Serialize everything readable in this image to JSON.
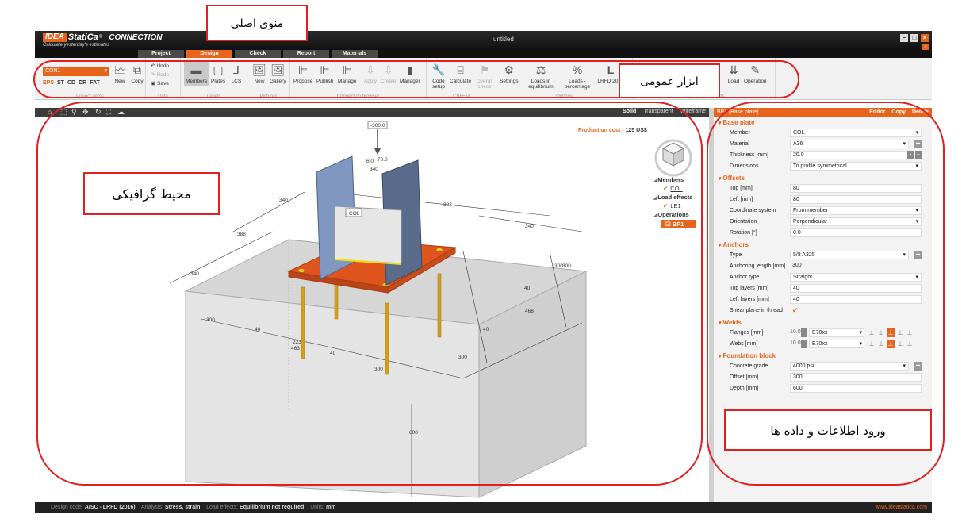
{
  "app": {
    "brand_idea": "IDEA",
    "brand_statica": "StatiCa",
    "product": "CONNECTION",
    "tagline": "Calculate yesterday's estimates",
    "document_title": "untitled"
  },
  "tabs": [
    {
      "label": "Project"
    },
    {
      "label": "Design"
    },
    {
      "label": "Check"
    },
    {
      "label": "Report"
    },
    {
      "label": "Materials"
    }
  ],
  "ribbon": {
    "connection_select": "CON1",
    "connection_types": [
      "EPS",
      "ST",
      "CD",
      "DR",
      "FAT"
    ],
    "project_items": {
      "new": "New",
      "copy": "Copy",
      "title": "Project items"
    },
    "data": {
      "undo": "Undo",
      "redo": "Redo",
      "save": "Save",
      "title": "Data"
    },
    "labels": {
      "members": "Members",
      "plates": "Plates",
      "lcs": "LCS",
      "title": "Labels"
    },
    "pictures": {
      "new": "New",
      "gallery": "Gallery",
      "title": "Pictures"
    },
    "connection_browser": {
      "propose": "Propose",
      "publish": "Publish",
      "manage": "Manage",
      "apply": "Apply",
      "create": "Create",
      "manager": "Manager",
      "title": "Connection browser"
    },
    "cbfem": {
      "code_setup": "Code setup",
      "calculate": "Calculate",
      "overall_check": "Overall check",
      "title": "CBFEM"
    },
    "options": {
      "settings": "Settings",
      "loads_eq": "Loads in equilibrium",
      "loads_pct": "Loads - percentage",
      "lrfd": "LRFD 2016",
      "title": "Options"
    },
    "import_export": {
      "load": "Load",
      "operation": "Operation",
      "title": "Import/Export loads"
    }
  },
  "view_modes": [
    "Solid",
    "Transparent",
    "Wireframe"
  ],
  "viewport": {
    "production_cost_label": "Production cost",
    "production_cost_value": "125 US$",
    "load_value": "-300.0",
    "member_label": "COL",
    "dims": {
      "d340a": "340",
      "d383": "383",
      "d340b": "340",
      "d388": "388",
      "d340c": "340",
      "d300a": "300",
      "d300b": "300",
      "d40a": "40",
      "d40b": "40",
      "d40c": "40",
      "d40d": "40",
      "d223": "223",
      "d463": "463",
      "d300c": "300",
      "d300d": "300",
      "d300e": "300",
      "d300f": "300",
      "d468": "468",
      "d600": "600",
      "d60": "6.0",
      "d70": "70.0",
      "d340t": "340"
    }
  },
  "tree": {
    "members_header": "Members",
    "member_item": "COL",
    "load_header": "Load effects",
    "load_item": "LE1",
    "ops_header": "Operations",
    "op_item": "BP1"
  },
  "panel": {
    "title": "BP1 [Base plate]",
    "actions": [
      "Editor",
      "Copy",
      "Delete"
    ],
    "base_plate": {
      "header": "Base plate",
      "member_label": "Member",
      "member": "COL",
      "material_label": "Material",
      "material": "A36",
      "thickness_label": "Thickness [mm]",
      "thickness": "20.0",
      "dimensions_label": "Dimensions",
      "dimensions": "To profile symmetrical"
    },
    "offsets": {
      "header": "Offsets",
      "top_label": "Top [mm]",
      "top": "80",
      "left_label": "Left [mm]",
      "left": "80",
      "coord_label": "Coordinate system",
      "coord": "From member",
      "orient_label": "Orientation",
      "orient": "Perpendicular",
      "rot_label": "Rotation [°]",
      "rot": "0.0"
    },
    "anchors": {
      "header": "Anchors",
      "type_label": "Type",
      "type": "5/8 A325",
      "anch_len_label": "Anchoring length [mm]",
      "anch_len": "300",
      "anchor_type_label": "Anchor type",
      "anchor_type": "Straight",
      "top_layers_label": "Top layers [mm]",
      "top_layers": "40",
      "left_layers_label": "Left layers [mm]",
      "left_layers": "40",
      "shear_label": "Shear plane in thread"
    },
    "welds": {
      "header": "Welds",
      "flanges_label": "Flanges [mm]",
      "flanges_size": "10.0",
      "flanges_mat": "E70xx",
      "webs_label": "Webs [mm]",
      "webs_size": "10.0",
      "webs_mat": "E70xx"
    },
    "foundation": {
      "header": "Foundation block",
      "grade_label": "Concrete grade",
      "grade": "4000 psi",
      "offset_label": "Offset [mm]",
      "offset": "300",
      "depth_label": "Depth [mm]",
      "depth": "600"
    }
  },
  "status": {
    "code_label": "Design code:",
    "code": "AISC - LRFD (2016)",
    "analysis_label": "Analysis:",
    "analysis": "Stress, strain",
    "load_label": "Load effects:",
    "load": "Equilibrium not required",
    "units_label": "Units:",
    "units": "mm",
    "url": "www.ideastatica.com"
  },
  "annotations": {
    "main_menu": "منوی اصلی",
    "general_tools": "ابزار عمومی",
    "graphic_env": "محیط گرافیکی",
    "data_entry": "ورود اطلاعات و داده ها"
  },
  "colors": {
    "accent": "#e8641b",
    "annotation": "#e02020",
    "steel": "#7f97c1",
    "plate": "#e0551e",
    "anchor": "#d4a017"
  }
}
